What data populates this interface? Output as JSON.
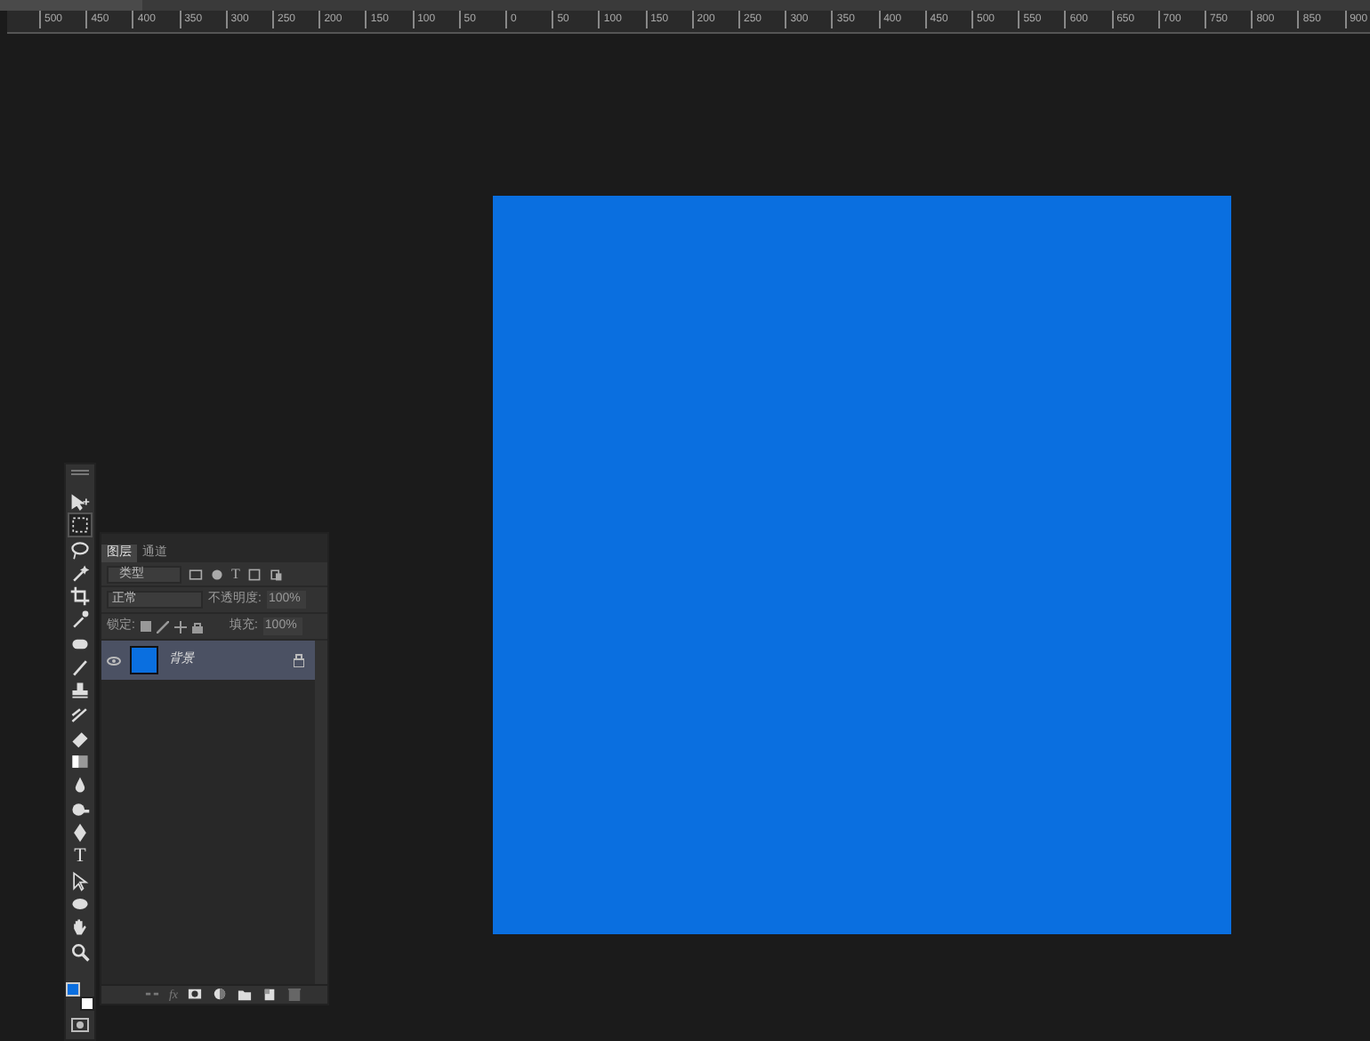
{
  "ruler": {
    "labels": [
      "500",
      "450",
      "400",
      "350",
      "300",
      "250",
      "200",
      "150",
      "100",
      "50",
      "0",
      "50",
      "100",
      "150",
      "200",
      "250",
      "300",
      "350",
      "400",
      "450",
      "500",
      "550",
      "600",
      "650",
      "700",
      "750",
      "800",
      "850",
      "900"
    ]
  },
  "canvas": {
    "color": "#0a6fe0"
  },
  "toolbar": {
    "tools": [
      {
        "kind": "move"
      },
      {
        "kind": "marquee",
        "selected": true
      },
      {
        "kind": "lasso"
      },
      {
        "kind": "wand"
      },
      {
        "kind": "crop"
      },
      {
        "kind": "eyedropper"
      },
      {
        "kind": "healing"
      },
      {
        "kind": "brush"
      },
      {
        "kind": "stamp"
      },
      {
        "kind": "history"
      },
      {
        "kind": "eraser"
      },
      {
        "kind": "gradient"
      },
      {
        "kind": "blur"
      },
      {
        "kind": "dodge"
      },
      {
        "kind": "pen"
      },
      {
        "kind": "type",
        "glyph": "T"
      },
      {
        "kind": "path"
      },
      {
        "kind": "ellipse"
      },
      {
        "kind": "hand"
      },
      {
        "kind": "zoom"
      }
    ],
    "swatches": [
      {
        "color": "#0a6fe0"
      },
      {
        "color": "#ffffff"
      }
    ]
  },
  "layers_panel": {
    "tabs": [
      {
        "label": "图层",
        "selected": true
      },
      {
        "label": "通道",
        "selected": false
      }
    ],
    "filter": {
      "label": "类型",
      "icons": [
        {
          "kind": "image"
        },
        {
          "kind": "adjust"
        },
        {
          "kind": "type",
          "glyph": "T"
        },
        {
          "kind": "shape"
        },
        {
          "kind": "smart"
        }
      ]
    },
    "blend_mode": "正常",
    "opacity_label": "不透明度:",
    "opacity": "100%",
    "lock_label": "锁定:",
    "fill_label": "填充:",
    "fill": "100%",
    "layers": [
      {
        "name": "背景",
        "visible": true,
        "selected": true,
        "locked": true,
        "color": "#0a6fe0"
      }
    ],
    "footer": [
      {
        "kind": "link"
      },
      {
        "kind": "fx",
        "glyph": "fx"
      },
      {
        "kind": "mask"
      },
      {
        "kind": "adjust"
      },
      {
        "kind": "folder"
      },
      {
        "kind": "new"
      },
      {
        "kind": "trash"
      }
    ]
  }
}
